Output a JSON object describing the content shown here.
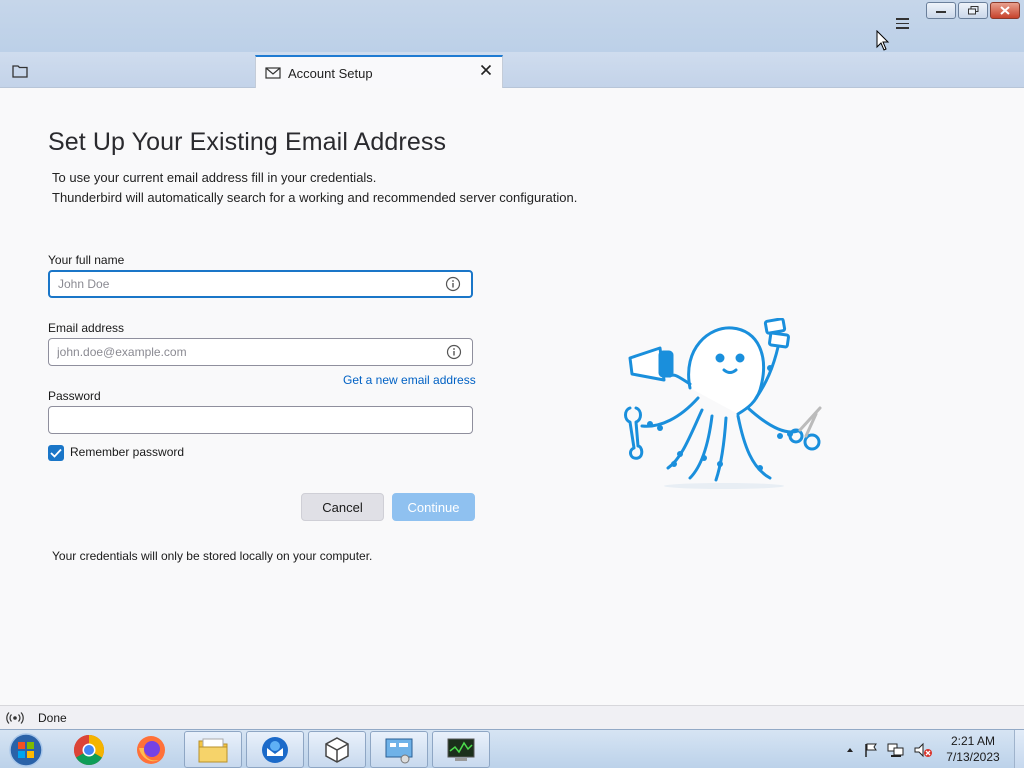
{
  "window": {
    "controls": [
      "minimize",
      "restore",
      "close"
    ]
  },
  "tabs": [
    {
      "label": "Account Setup",
      "icon": "mail-icon",
      "active": true
    }
  ],
  "form": {
    "heading": "Set Up Your Existing Email Address",
    "intro_line1": "To use your current email address fill in your credentials.",
    "intro_line2": "Thunderbird will automatically search for a working and recommended server configuration.",
    "full_name": {
      "label": "Your full name",
      "placeholder": "John Doe",
      "value": ""
    },
    "email": {
      "label": "Email address",
      "placeholder": "john.doe@example.com",
      "value": ""
    },
    "get_new_email_link": "Get a new email address",
    "password": {
      "label": "Password",
      "value": ""
    },
    "remember_password": {
      "label": "Remember password",
      "checked": true
    },
    "cancel_label": "Cancel",
    "continue_label": "Continue",
    "footnote": "Your credentials will only be stored locally on your computer."
  },
  "statusbar": {
    "text": "Done"
  },
  "taskbar": {
    "apps": [
      "chrome",
      "firefox",
      "file-explorer",
      "thunderbird",
      "virtualbox",
      "control-panel",
      "task-manager"
    ],
    "time": "2:21 AM",
    "date": "7/13/2023"
  },
  "colors": {
    "accent": "#1a76c8",
    "link": "#0061c4",
    "continue_disabled": "#8fc1f0"
  }
}
